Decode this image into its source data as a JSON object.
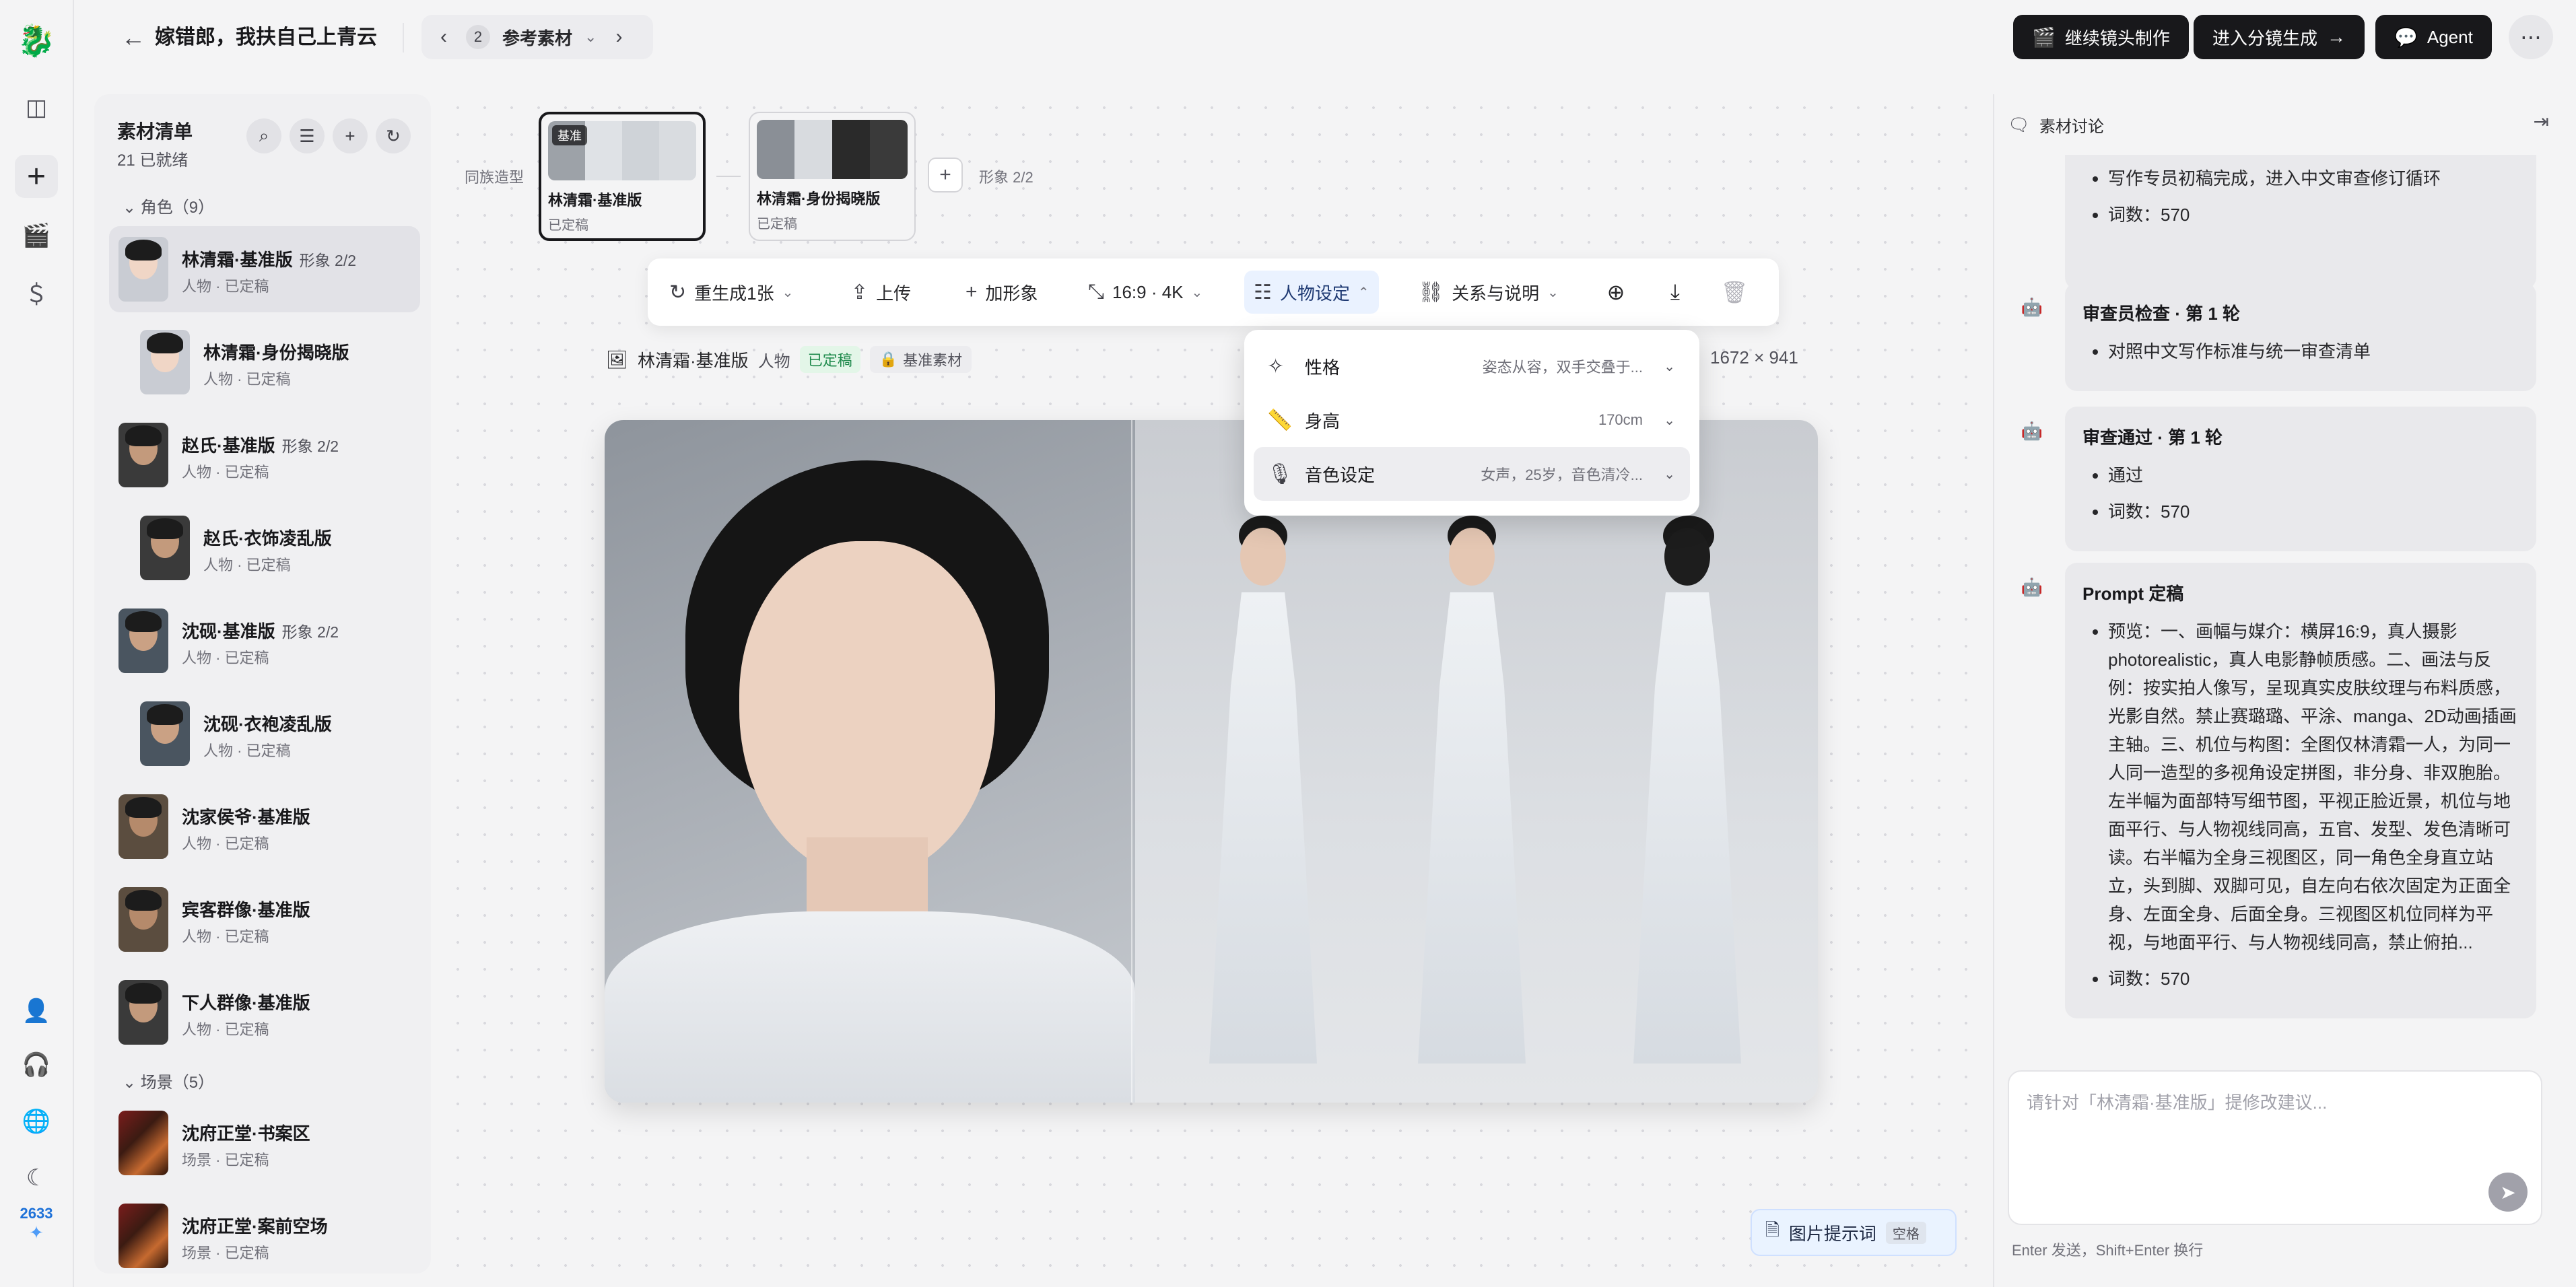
{
  "header": {
    "back_icon": "arrow-left-icon",
    "title": "嫁错郎，我扶自己上青云",
    "pager": {
      "number": "2",
      "label": "参考素材"
    },
    "buttons": {
      "continue_shots": "继续镜头制作",
      "enter_storyboard": "进入分镜生成",
      "agent": "Agent"
    }
  },
  "rail": {
    "counter": "2633"
  },
  "assets": {
    "title": "素材清单",
    "count": "21 已就绪",
    "groups": [
      {
        "label": "角色（9）"
      },
      {
        "label": "场景（5）"
      }
    ],
    "items": [
      {
        "name": "林清霜·基准版",
        "tag": "形象 2/2",
        "meta": "人物 · 已定稿"
      },
      {
        "name": "林清霜·身份揭晓版",
        "tag": "",
        "meta": "人物 · 已定稿"
      },
      {
        "name": "赵氏·基准版",
        "tag": "形象 2/2",
        "meta": "人物 · 已定稿"
      },
      {
        "name": "赵氏·衣饰凌乱版",
        "tag": "",
        "meta": "人物 · 已定稿"
      },
      {
        "name": "沈砚·基准版",
        "tag": "形象 2/2",
        "meta": "人物 · 已定稿"
      },
      {
        "name": "沈砚·衣袍凌乱版",
        "tag": "",
        "meta": "人物 · 已定稿"
      },
      {
        "name": "沈家侯爷·基准版",
        "tag": "",
        "meta": "人物 · 已定稿"
      },
      {
        "name": "宾客群像·基准版",
        "tag": "",
        "meta": "人物 · 已定稿"
      },
      {
        "name": "下人群像·基准版",
        "tag": "",
        "meta": "人物 · 已定稿"
      },
      {
        "name": "沈府正堂·书案区",
        "tag": "",
        "meta": "场景 · 已定稿"
      },
      {
        "name": "沈府正堂·案前空场",
        "tag": "",
        "meta": "场景 · 已定稿"
      }
    ]
  },
  "strip": {
    "label": "同族造型",
    "variants": [
      {
        "name": "林清霜·基准版",
        "status": "已定稿",
        "badge": "基准"
      },
      {
        "name": "林清霜·身份揭晓版",
        "status": "已定稿"
      }
    ],
    "count": "形象 2/2"
  },
  "toolbar": {
    "regenerate": "重生成1张",
    "upload": "上传",
    "add_look": "加形象",
    "ratio": "16:9 · 4K",
    "character_settings": "人物设定",
    "relations": "关系与说明"
  },
  "info": {
    "name": "林清霜·基准版",
    "kind": "人物",
    "status": "已定稿",
    "base_tag": "基准素材",
    "dims": "1672 × 941"
  },
  "dropdown": [
    {
      "label": "性格",
      "value": "姿态从容，双手交叠于..."
    },
    {
      "label": "身高",
      "value": "170cm"
    },
    {
      "label": "音色设定",
      "value": "女声，25岁，音色清冷..."
    }
  ],
  "prompt_button": {
    "label": "图片提示词",
    "kbd": "空格"
  },
  "discussion": {
    "title": "素材讨论",
    "messages": [
      {
        "title": "",
        "bullets": [
          "写作专员初稿完成，进入中文审查修订循环",
          "词数：570"
        ]
      },
      {
        "title": "审查员检查 · 第 1 轮",
        "bullets": [
          "对照中文写作标准与统一审查清单"
        ]
      },
      {
        "title": "审查通过 · 第 1 轮",
        "bullets": [
          "通过",
          "词数：570"
        ]
      },
      {
        "title": "Prompt 定稿",
        "bullets": [
          "预览：一、画幅与媒介：横屏16:9，真人摄影photorealistic，真人电影静帧质感。二、画法与反例：按实拍人像写，呈现真实皮肤纹理与布料质感，光影自然。禁止赛璐璐、平涂、manga、2D动画插画主轴。三、机位与构图：全图仅林清霜一人，为同一人同一造型的多视角设定拼图，非分身、非双胞胎。左半幅为面部特写细节图，平视正脸近景，机位与地面平行、与人物视线同高，五官、发型、发色清晰可读。右半幅为全身三视图区，同一角色全身直立站立，头到脚、双脚可见，自左向右依次固定为正面全身、左面全身、后面全身。三视图区机位同样为平视，与地面平行、与人物视线同高，禁止俯拍...",
          "词数：570"
        ]
      }
    ],
    "composer_placeholder": "请针对「林清霜·基准版」提修改建议...",
    "hint": "Enter 发送，Shift+Enter 换行"
  }
}
